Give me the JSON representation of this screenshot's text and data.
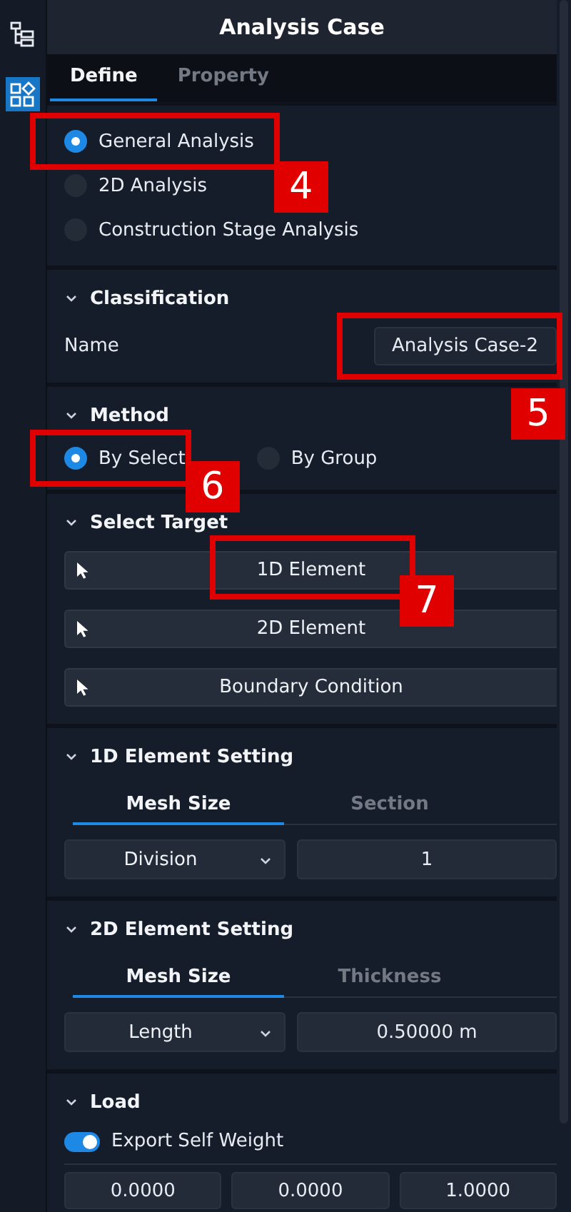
{
  "rail": [
    {
      "kind": "tree",
      "selected": false
    },
    {
      "kind": "grid",
      "selected": true
    }
  ],
  "title": "Analysis Case",
  "tabs": [
    {
      "label": "Define",
      "selected": true
    },
    {
      "label": "Property",
      "selected": false
    }
  ],
  "analysis_types": [
    {
      "label": "General Analysis",
      "selected": true,
      "callout": "4"
    },
    {
      "label": "2D Analysis",
      "selected": false
    },
    {
      "label": "Construction Stage Analysis",
      "selected": false
    }
  ],
  "classification": {
    "title": "Classification",
    "expanded": true,
    "name_label": "Name",
    "name_value": "Analysis Case-2",
    "callout": "5"
  },
  "method": {
    "title": "Method",
    "expanded": true,
    "options": [
      {
        "label": "By Select",
        "selected": true,
        "callout": "6"
      },
      {
        "label": "By Group",
        "selected": false
      }
    ]
  },
  "select_target": {
    "title": "Select Target",
    "expanded": true,
    "buttons": [
      {
        "label": "1D Element",
        "callout": "7"
      },
      {
        "label": "2D Element"
      },
      {
        "label": "Boundary Condition"
      }
    ]
  },
  "settings": [
    {
      "title": "1D Element Setting",
      "expanded": true,
      "tabs": [
        {
          "label": "Mesh Size",
          "selected": true
        },
        {
          "label": "Section",
          "selected": false
        }
      ],
      "dropdown": "Division",
      "value": "1"
    },
    {
      "title": "2D Element Setting",
      "expanded": true,
      "tabs": [
        {
          "label": "Mesh Size",
          "selected": true
        },
        {
          "label": "Thickness",
          "selected": false
        }
      ],
      "dropdown": "Length",
      "value": "0.50000 m"
    }
  ],
  "load": {
    "title": "Load",
    "expanded": true,
    "toggle_label": "Export Self Weight",
    "toggle_on": true,
    "values": [
      "0.0000",
      "0.0000",
      "1.0000"
    ]
  }
}
